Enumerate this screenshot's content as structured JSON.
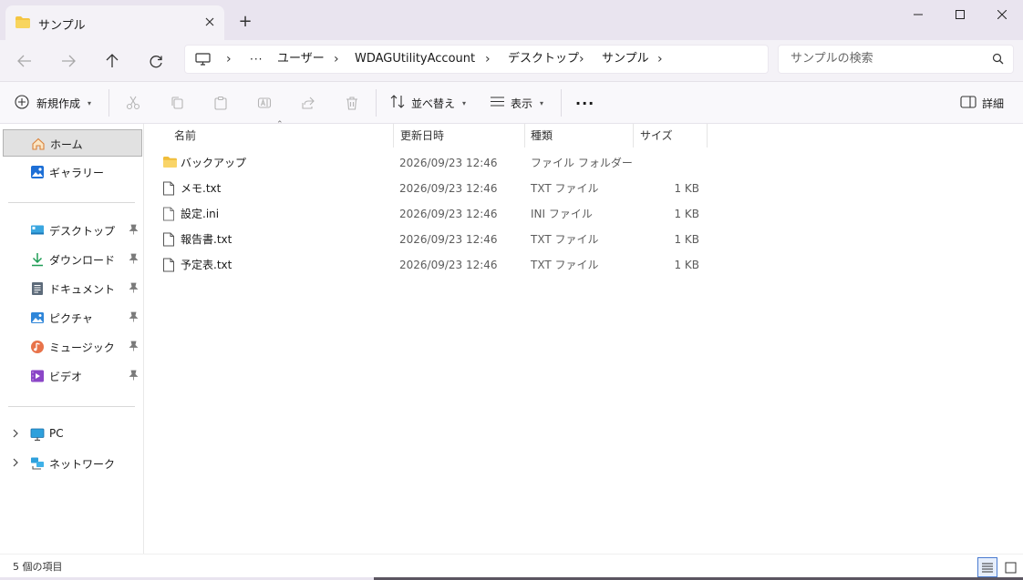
{
  "window": {
    "tab_title": "サンプル",
    "new_tab_label": "+",
    "minimize_glyph": "—",
    "maximize_glyph": "☐",
    "close_glyph": "✕"
  },
  "address": {
    "ellipsis": "···",
    "crumbs": [
      "ユーザー",
      "WDAGUtilityAccount",
      "デスクトップ",
      "サンプル"
    ],
    "chevron": "›"
  },
  "search": {
    "placeholder": "サンプルの検索"
  },
  "toolbar": {
    "new_label": "新規作成",
    "sort_label": "並べ替え",
    "view_label": "表示",
    "more_label": "···",
    "details_label": "詳細"
  },
  "sidebar": {
    "home": "ホーム",
    "gallery": "ギャラリー",
    "pinned": [
      "デスクトップ",
      "ダウンロード",
      "ドキュメント",
      "ピクチャ",
      "ミュージック",
      "ビデオ"
    ],
    "pc": "PC",
    "network": "ネットワーク"
  },
  "columns": {
    "name": "名前",
    "modified": "更新日時",
    "type": "種類",
    "size": "サイズ"
  },
  "files": [
    {
      "name": "バックアップ",
      "modified": "2026/09/23 12:46",
      "type": "ファイル フォルダー",
      "size": ""
    },
    {
      "name": "メモ.txt",
      "modified": "2026/09/23 12:46",
      "type": "TXT ファイル",
      "size": "1 KB"
    },
    {
      "name": "設定.ini",
      "modified": "2026/09/23 12:46",
      "type": "INI ファイル",
      "size": "1 KB"
    },
    {
      "name": "報告書.txt",
      "modified": "2026/09/23 12:46",
      "type": "TXT ファイル",
      "size": "1 KB"
    },
    {
      "name": "予定表.txt",
      "modified": "2026/09/23 12:46",
      "type": "TXT ファイル",
      "size": "1 KB"
    }
  ],
  "status": {
    "item_count": "5 個の項目"
  },
  "colors": {
    "folder": "#f4c542",
    "accent": "#0a64c8",
    "pin": "#7a7a7a"
  }
}
